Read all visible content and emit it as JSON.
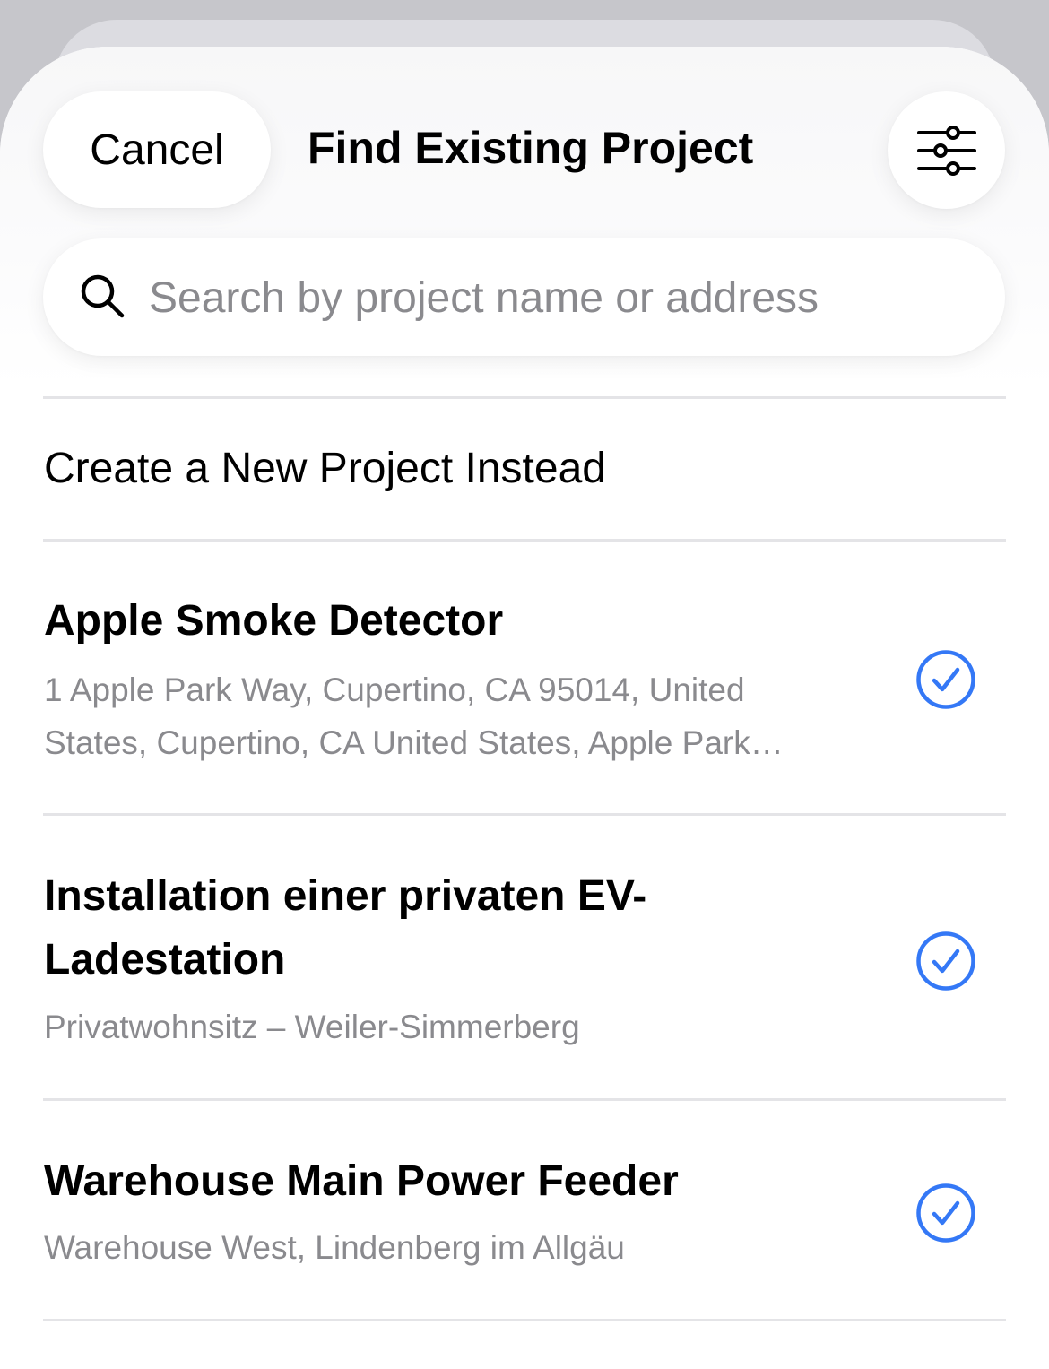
{
  "header": {
    "cancel_label": "Cancel",
    "title": "Find Existing Project",
    "filter_icon": "sliders-icon"
  },
  "search": {
    "placeholder": "Search by project name or address",
    "value": "",
    "icon": "magnifying-glass-icon"
  },
  "create_new": {
    "label": "Create a New Project Instead"
  },
  "projects": [
    {
      "title": "Apple Smoke Detector",
      "subtitle_line1": "1 Apple Park Way, Cupertino, CA  95014, United",
      "subtitle_line2": "States, Cupertino, CA United States, Apple Park…",
      "status_icon": "checkmark-circle-icon"
    },
    {
      "title_line1": "Installation einer privaten EV-",
      "title_line2": "Ladestation",
      "subtitle": "Privatwohnsitz – Weiler-Simmerberg",
      "status_icon": "checkmark-circle-icon"
    },
    {
      "title": "Warehouse Main Power Feeder",
      "subtitle": "Warehouse West, Lindenberg im Allgäu",
      "status_icon": "checkmark-circle-icon"
    }
  ],
  "colors": {
    "accent": "#3478f6",
    "secondary_text": "#8a8a8e",
    "separator": "#e4e4e7"
  }
}
